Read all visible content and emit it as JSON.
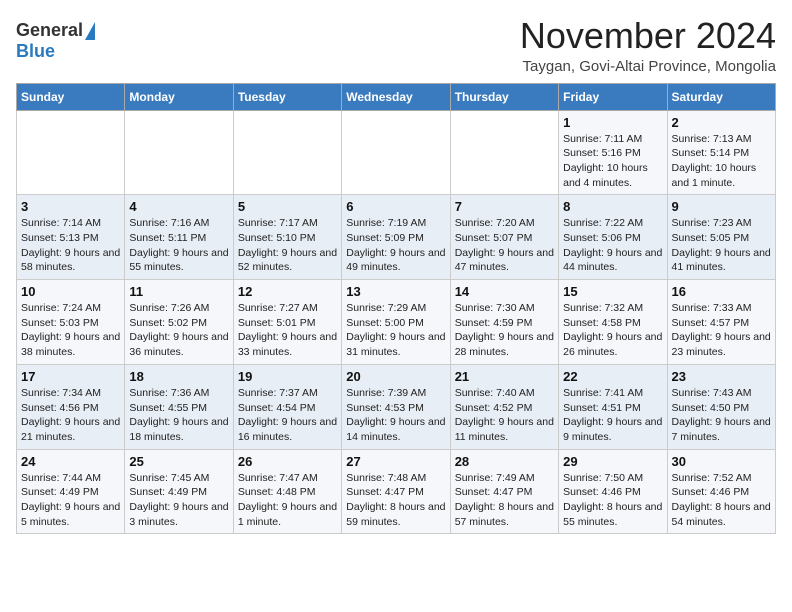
{
  "logo": {
    "general": "General",
    "blue": "Blue"
  },
  "title": "November 2024",
  "location": "Taygan, Govi-Altai Province, Mongolia",
  "days_header": [
    "Sunday",
    "Monday",
    "Tuesday",
    "Wednesday",
    "Thursday",
    "Friday",
    "Saturday"
  ],
  "weeks": [
    [
      {
        "day": "",
        "sunrise": "",
        "sunset": "",
        "daylight": ""
      },
      {
        "day": "",
        "sunrise": "",
        "sunset": "",
        "daylight": ""
      },
      {
        "day": "",
        "sunrise": "",
        "sunset": "",
        "daylight": ""
      },
      {
        "day": "",
        "sunrise": "",
        "sunset": "",
        "daylight": ""
      },
      {
        "day": "",
        "sunrise": "",
        "sunset": "",
        "daylight": ""
      },
      {
        "day": "1",
        "sunrise": "Sunrise: 7:11 AM",
        "sunset": "Sunset: 5:16 PM",
        "daylight": "Daylight: 10 hours and 4 minutes."
      },
      {
        "day": "2",
        "sunrise": "Sunrise: 7:13 AM",
        "sunset": "Sunset: 5:14 PM",
        "daylight": "Daylight: 10 hours and 1 minute."
      }
    ],
    [
      {
        "day": "3",
        "sunrise": "Sunrise: 7:14 AM",
        "sunset": "Sunset: 5:13 PM",
        "daylight": "Daylight: 9 hours and 58 minutes."
      },
      {
        "day": "4",
        "sunrise": "Sunrise: 7:16 AM",
        "sunset": "Sunset: 5:11 PM",
        "daylight": "Daylight: 9 hours and 55 minutes."
      },
      {
        "day": "5",
        "sunrise": "Sunrise: 7:17 AM",
        "sunset": "Sunset: 5:10 PM",
        "daylight": "Daylight: 9 hours and 52 minutes."
      },
      {
        "day": "6",
        "sunrise": "Sunrise: 7:19 AM",
        "sunset": "Sunset: 5:09 PM",
        "daylight": "Daylight: 9 hours and 49 minutes."
      },
      {
        "day": "7",
        "sunrise": "Sunrise: 7:20 AM",
        "sunset": "Sunset: 5:07 PM",
        "daylight": "Daylight: 9 hours and 47 minutes."
      },
      {
        "day": "8",
        "sunrise": "Sunrise: 7:22 AM",
        "sunset": "Sunset: 5:06 PM",
        "daylight": "Daylight: 9 hours and 44 minutes."
      },
      {
        "day": "9",
        "sunrise": "Sunrise: 7:23 AM",
        "sunset": "Sunset: 5:05 PM",
        "daylight": "Daylight: 9 hours and 41 minutes."
      }
    ],
    [
      {
        "day": "10",
        "sunrise": "Sunrise: 7:24 AM",
        "sunset": "Sunset: 5:03 PM",
        "daylight": "Daylight: 9 hours and 38 minutes."
      },
      {
        "day": "11",
        "sunrise": "Sunrise: 7:26 AM",
        "sunset": "Sunset: 5:02 PM",
        "daylight": "Daylight: 9 hours and 36 minutes."
      },
      {
        "day": "12",
        "sunrise": "Sunrise: 7:27 AM",
        "sunset": "Sunset: 5:01 PM",
        "daylight": "Daylight: 9 hours and 33 minutes."
      },
      {
        "day": "13",
        "sunrise": "Sunrise: 7:29 AM",
        "sunset": "Sunset: 5:00 PM",
        "daylight": "Daylight: 9 hours and 31 minutes."
      },
      {
        "day": "14",
        "sunrise": "Sunrise: 7:30 AM",
        "sunset": "Sunset: 4:59 PM",
        "daylight": "Daylight: 9 hours and 28 minutes."
      },
      {
        "day": "15",
        "sunrise": "Sunrise: 7:32 AM",
        "sunset": "Sunset: 4:58 PM",
        "daylight": "Daylight: 9 hours and 26 minutes."
      },
      {
        "day": "16",
        "sunrise": "Sunrise: 7:33 AM",
        "sunset": "Sunset: 4:57 PM",
        "daylight": "Daylight: 9 hours and 23 minutes."
      }
    ],
    [
      {
        "day": "17",
        "sunrise": "Sunrise: 7:34 AM",
        "sunset": "Sunset: 4:56 PM",
        "daylight": "Daylight: 9 hours and 21 minutes."
      },
      {
        "day": "18",
        "sunrise": "Sunrise: 7:36 AM",
        "sunset": "Sunset: 4:55 PM",
        "daylight": "Daylight: 9 hours and 18 minutes."
      },
      {
        "day": "19",
        "sunrise": "Sunrise: 7:37 AM",
        "sunset": "Sunset: 4:54 PM",
        "daylight": "Daylight: 9 hours and 16 minutes."
      },
      {
        "day": "20",
        "sunrise": "Sunrise: 7:39 AM",
        "sunset": "Sunset: 4:53 PM",
        "daylight": "Daylight: 9 hours and 14 minutes."
      },
      {
        "day": "21",
        "sunrise": "Sunrise: 7:40 AM",
        "sunset": "Sunset: 4:52 PM",
        "daylight": "Daylight: 9 hours and 11 minutes."
      },
      {
        "day": "22",
        "sunrise": "Sunrise: 7:41 AM",
        "sunset": "Sunset: 4:51 PM",
        "daylight": "Daylight: 9 hours and 9 minutes."
      },
      {
        "day": "23",
        "sunrise": "Sunrise: 7:43 AM",
        "sunset": "Sunset: 4:50 PM",
        "daylight": "Daylight: 9 hours and 7 minutes."
      }
    ],
    [
      {
        "day": "24",
        "sunrise": "Sunrise: 7:44 AM",
        "sunset": "Sunset: 4:49 PM",
        "daylight": "Daylight: 9 hours and 5 minutes."
      },
      {
        "day": "25",
        "sunrise": "Sunrise: 7:45 AM",
        "sunset": "Sunset: 4:49 PM",
        "daylight": "Daylight: 9 hours and 3 minutes."
      },
      {
        "day": "26",
        "sunrise": "Sunrise: 7:47 AM",
        "sunset": "Sunset: 4:48 PM",
        "daylight": "Daylight: 9 hours and 1 minute."
      },
      {
        "day": "27",
        "sunrise": "Sunrise: 7:48 AM",
        "sunset": "Sunset: 4:47 PM",
        "daylight": "Daylight: 8 hours and 59 minutes."
      },
      {
        "day": "28",
        "sunrise": "Sunrise: 7:49 AM",
        "sunset": "Sunset: 4:47 PM",
        "daylight": "Daylight: 8 hours and 57 minutes."
      },
      {
        "day": "29",
        "sunrise": "Sunrise: 7:50 AM",
        "sunset": "Sunset: 4:46 PM",
        "daylight": "Daylight: 8 hours and 55 minutes."
      },
      {
        "day": "30",
        "sunrise": "Sunrise: 7:52 AM",
        "sunset": "Sunset: 4:46 PM",
        "daylight": "Daylight: 8 hours and 54 minutes."
      }
    ]
  ]
}
